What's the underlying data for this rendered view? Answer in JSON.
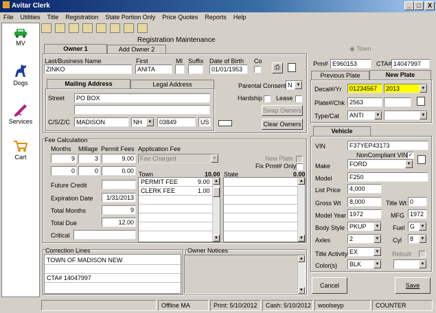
{
  "window": {
    "title": "Avitar Clerk",
    "min": "_",
    "max": "□",
    "close": "X"
  },
  "menu": [
    "File",
    "Utilities",
    "Title",
    "Registration",
    "State Portion Only",
    "Price Quotes",
    "Reports",
    "Help"
  ],
  "sidebar": [
    {
      "label": "MV",
      "icon": "car-icon"
    },
    {
      "label": "Dogs",
      "icon": "dog-icon"
    },
    {
      "label": "Services",
      "icon": "pen-icon"
    },
    {
      "label": "Cart",
      "icon": "cart-icon"
    }
  ],
  "form_title": "Registration Maintenance",
  "owner_tabs": [
    "Owner 1",
    "Add Owner 2"
  ],
  "owner": {
    "last_label": "Last/Business Name",
    "last": "ZINKO",
    "first_label": "First",
    "first": "ANITA",
    "mi_label": "MI",
    "suffix_label": "Suffix",
    "dob_label": "Date of Birth",
    "dob": "01/01/1953",
    "co_label": "Co"
  },
  "address_tabs": [
    "Mailing Address",
    "Legal Address"
  ],
  "address": {
    "street_label": "Street",
    "street1": "PO BOX",
    "street2": "",
    "cszc_label": "C/S/Z/C",
    "city": "MADISON",
    "state": "NH",
    "zip": "03849",
    "country": "US"
  },
  "parental_consent": {
    "label": "Parental Consent",
    "value": "N"
  },
  "hardship_label": "Hardship",
  "lease_label": "Lease",
  "swap_owners": "Swap Owners",
  "clear_owners": "Clear Owners",
  "town_label": "Town",
  "prm": {
    "label": "Prm#",
    "value": "E960153",
    "cta_label": "CTA#",
    "cta_value": "14047997"
  },
  "plate_tabs": [
    "Previous Plate",
    "New Plate"
  ],
  "plate": {
    "decal_label": "Decal#/Yr",
    "decal": "01234567",
    "year": "2013",
    "plate_label": "Plate#/Chk",
    "plate": "2563",
    "chk": "",
    "type_label": "Type/Cat",
    "type": "ANTI",
    "cat": ""
  },
  "fee": {
    "title": "Fee Calculation",
    "months_label": "Months",
    "millage_label": "Millage",
    "permit_label": "Permit Fees",
    "app_fee_label": "Application Fee",
    "months": "9",
    "millage": "3",
    "permit": "9.00",
    "row2_a": "0",
    "row2_b": "0",
    "row2_c": "0.00",
    "app_fee_value": "Fee Charged",
    "future_credit_label": "Future Credit",
    "future_credit": "",
    "expiration_label": "Expiration Date",
    "expiration": "1/31/2013",
    "total_months_label": "Total Months",
    "total_months": "9",
    "total_due_label": "Total Due",
    "total_due": "12.00",
    "critical_label": "Critical",
    "critical": "",
    "new_plate_label": "New Plate",
    "fix_prmt_label": "Fix Prmt# Only",
    "town_label": "Town",
    "town_total": "10.00",
    "state_label": "State",
    "state_total": "0.00",
    "town_rows": [
      {
        "name": "PERMIT FEE",
        "amount": "9.00"
      },
      {
        "name": "CLERK FEE",
        "amount": "1.00"
      }
    ]
  },
  "correction": {
    "label": "Correction Lines",
    "lines": [
      "TOWN OF MADISON NEW",
      "",
      "CTA# 14047997",
      ""
    ]
  },
  "owner_notices_label": "Owner Notices",
  "vehicle": {
    "tab": "Vehicle",
    "vin_label": "VIN",
    "vin": "F37YEP43173",
    "noncompliant_label": "NonCompliant VIN",
    "make_label": "Make",
    "make": "FORD",
    "model_label": "Model",
    "model": "F250",
    "list_price_label": "List Price",
    "list_price": "4,000",
    "gross_wt_label": "Gross Wt",
    "gross_wt": "8,000",
    "title_wt_label": "Title Wt",
    "title_wt": "0",
    "model_year_label": "Model Year",
    "model_year": "1972",
    "mfg_label": "MFG",
    "mfg": "1972",
    "body_label": "Body Style",
    "body": "PKUP",
    "fuel_label": "Fuel",
    "fuel": "G",
    "axles_label": "Axles",
    "axles": "2",
    "cyl_label": "Cyl",
    "cyl": "8",
    "title_activity_label": "Title Activity",
    "title_activity": "EX",
    "rebuilt_label": "Rebuilt",
    "colors_label": "Color(s)",
    "color1": "BLK",
    "color2": ""
  },
  "cancel": "Cancel",
  "save": "Save",
  "status": {
    "mode": "Offline MA",
    "print": "Print: 5/10/2012",
    "cash": "Cash: 5/10/2012",
    "user": "woolseyp",
    "station": "COUNTER"
  },
  "colors": {
    "title_bar": "#0a246a",
    "highlight": "#ffff00",
    "face": "#d4d0c8"
  }
}
